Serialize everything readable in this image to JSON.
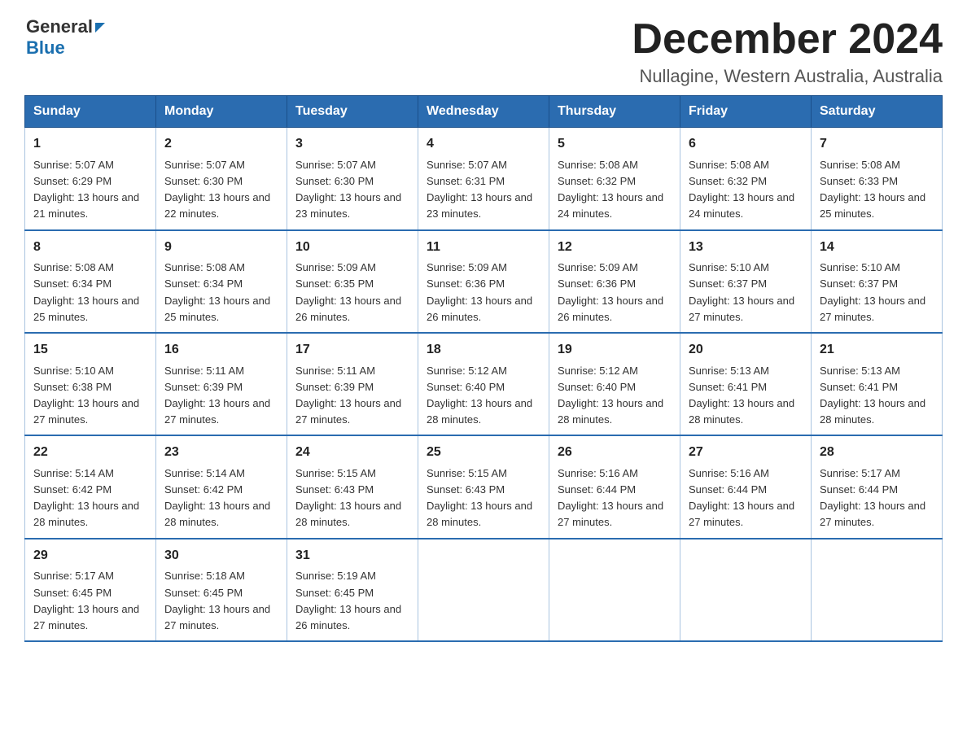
{
  "logo": {
    "general": "General",
    "blue": "Blue",
    "triangle": "▶"
  },
  "header": {
    "month_year": "December 2024",
    "location": "Nullagine, Western Australia, Australia"
  },
  "weekdays": [
    "Sunday",
    "Monday",
    "Tuesday",
    "Wednesday",
    "Thursday",
    "Friday",
    "Saturday"
  ],
  "weeks": [
    [
      {
        "day": "1",
        "sunrise": "5:07 AM",
        "sunset": "6:29 PM",
        "daylight": "13 hours and 21 minutes."
      },
      {
        "day": "2",
        "sunrise": "5:07 AM",
        "sunset": "6:30 PM",
        "daylight": "13 hours and 22 minutes."
      },
      {
        "day": "3",
        "sunrise": "5:07 AM",
        "sunset": "6:30 PM",
        "daylight": "13 hours and 23 minutes."
      },
      {
        "day": "4",
        "sunrise": "5:07 AM",
        "sunset": "6:31 PM",
        "daylight": "13 hours and 23 minutes."
      },
      {
        "day": "5",
        "sunrise": "5:08 AM",
        "sunset": "6:32 PM",
        "daylight": "13 hours and 24 minutes."
      },
      {
        "day": "6",
        "sunrise": "5:08 AM",
        "sunset": "6:32 PM",
        "daylight": "13 hours and 24 minutes."
      },
      {
        "day": "7",
        "sunrise": "5:08 AM",
        "sunset": "6:33 PM",
        "daylight": "13 hours and 25 minutes."
      }
    ],
    [
      {
        "day": "8",
        "sunrise": "5:08 AM",
        "sunset": "6:34 PM",
        "daylight": "13 hours and 25 minutes."
      },
      {
        "day": "9",
        "sunrise": "5:08 AM",
        "sunset": "6:34 PM",
        "daylight": "13 hours and 25 minutes."
      },
      {
        "day": "10",
        "sunrise": "5:09 AM",
        "sunset": "6:35 PM",
        "daylight": "13 hours and 26 minutes."
      },
      {
        "day": "11",
        "sunrise": "5:09 AM",
        "sunset": "6:36 PM",
        "daylight": "13 hours and 26 minutes."
      },
      {
        "day": "12",
        "sunrise": "5:09 AM",
        "sunset": "6:36 PM",
        "daylight": "13 hours and 26 minutes."
      },
      {
        "day": "13",
        "sunrise": "5:10 AM",
        "sunset": "6:37 PM",
        "daylight": "13 hours and 27 minutes."
      },
      {
        "day": "14",
        "sunrise": "5:10 AM",
        "sunset": "6:37 PM",
        "daylight": "13 hours and 27 minutes."
      }
    ],
    [
      {
        "day": "15",
        "sunrise": "5:10 AM",
        "sunset": "6:38 PM",
        "daylight": "13 hours and 27 minutes."
      },
      {
        "day": "16",
        "sunrise": "5:11 AM",
        "sunset": "6:39 PM",
        "daylight": "13 hours and 27 minutes."
      },
      {
        "day": "17",
        "sunrise": "5:11 AM",
        "sunset": "6:39 PM",
        "daylight": "13 hours and 27 minutes."
      },
      {
        "day": "18",
        "sunrise": "5:12 AM",
        "sunset": "6:40 PM",
        "daylight": "13 hours and 28 minutes."
      },
      {
        "day": "19",
        "sunrise": "5:12 AM",
        "sunset": "6:40 PM",
        "daylight": "13 hours and 28 minutes."
      },
      {
        "day": "20",
        "sunrise": "5:13 AM",
        "sunset": "6:41 PM",
        "daylight": "13 hours and 28 minutes."
      },
      {
        "day": "21",
        "sunrise": "5:13 AM",
        "sunset": "6:41 PM",
        "daylight": "13 hours and 28 minutes."
      }
    ],
    [
      {
        "day": "22",
        "sunrise": "5:14 AM",
        "sunset": "6:42 PM",
        "daylight": "13 hours and 28 minutes."
      },
      {
        "day": "23",
        "sunrise": "5:14 AM",
        "sunset": "6:42 PM",
        "daylight": "13 hours and 28 minutes."
      },
      {
        "day": "24",
        "sunrise": "5:15 AM",
        "sunset": "6:43 PM",
        "daylight": "13 hours and 28 minutes."
      },
      {
        "day": "25",
        "sunrise": "5:15 AM",
        "sunset": "6:43 PM",
        "daylight": "13 hours and 28 minutes."
      },
      {
        "day": "26",
        "sunrise": "5:16 AM",
        "sunset": "6:44 PM",
        "daylight": "13 hours and 27 minutes."
      },
      {
        "day": "27",
        "sunrise": "5:16 AM",
        "sunset": "6:44 PM",
        "daylight": "13 hours and 27 minutes."
      },
      {
        "day": "28",
        "sunrise": "5:17 AM",
        "sunset": "6:44 PM",
        "daylight": "13 hours and 27 minutes."
      }
    ],
    [
      {
        "day": "29",
        "sunrise": "5:17 AM",
        "sunset": "6:45 PM",
        "daylight": "13 hours and 27 minutes."
      },
      {
        "day": "30",
        "sunrise": "5:18 AM",
        "sunset": "6:45 PM",
        "daylight": "13 hours and 27 minutes."
      },
      {
        "day": "31",
        "sunrise": "5:19 AM",
        "sunset": "6:45 PM",
        "daylight": "13 hours and 26 minutes."
      },
      null,
      null,
      null,
      null
    ]
  ],
  "labels": {
    "sunrise": "Sunrise:",
    "sunset": "Sunset:",
    "daylight": "Daylight:"
  }
}
